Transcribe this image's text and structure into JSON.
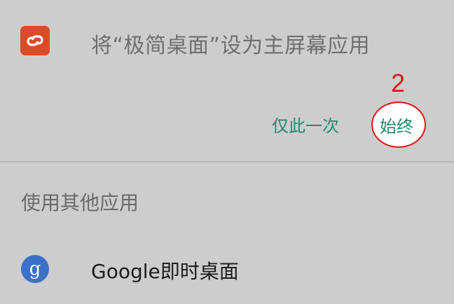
{
  "dialog": {
    "app_title": "将“极简桌面”设为主屏幕应用",
    "app_icon": "link-icon",
    "accent_color": "#1e8a6d",
    "actions": {
      "once_label": "仅此一次",
      "always_label": "始终"
    },
    "annotation": {
      "step_number": "2",
      "color": "#e01818"
    },
    "section_header": "使用其他应用",
    "other_apps": [
      {
        "name": "Google即时桌面",
        "icon": "google-g-icon",
        "icon_glyph": "g"
      }
    ]
  }
}
